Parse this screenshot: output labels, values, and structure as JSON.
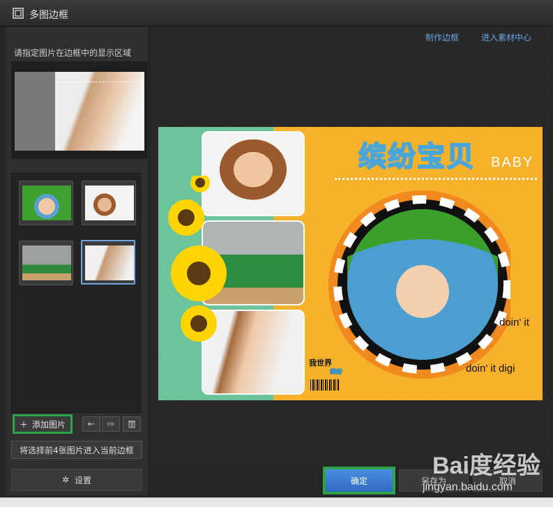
{
  "window": {
    "title": "多图边框"
  },
  "left": {
    "instruction": "请指定图片在边框中的显示区域",
    "thumbnails": [
      {
        "name": "thumb-kid-grass",
        "selected": false,
        "color": "#3fa02f"
      },
      {
        "name": "thumb-girl-laugh",
        "selected": false,
        "color": "#e9e9e9"
      },
      {
        "name": "thumb-boy-table",
        "selected": false,
        "color": "#7a8a60"
      },
      {
        "name": "thumb-girl-smile",
        "selected": true,
        "color": "#eeeeee"
      }
    ],
    "add_button": "添加图片",
    "apply_button": "将选择前4张图片进入当前边框",
    "settings_button": "设置"
  },
  "right": {
    "links": {
      "make_frame": "制作边框",
      "enter_material": "进入素材中心"
    },
    "collage": {
      "title": "缤纷宝贝",
      "subtitle": "BABY",
      "caption1": "doin' it",
      "caption2": "doin' it digi",
      "logo_line1": "我世界",
      "logo_line2": "缤纷",
      "colors": {
        "left_band": "#6cc59a",
        "right_band": "#f7b12b",
        "title_stroke": "#4aa6d8"
      }
    }
  },
  "footer": {
    "ok": "确定",
    "save_as": "另存为",
    "cancel": "取消"
  },
  "watermark": {
    "brand": "Bai度经验",
    "url": "jingyan.baidu.com"
  },
  "accent": {
    "highlight": "#2ea34a",
    "link": "#6aa5e0",
    "selection": "#6fa7de"
  }
}
